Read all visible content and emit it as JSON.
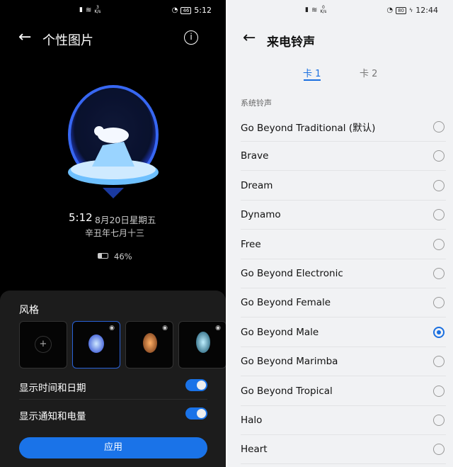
{
  "left": {
    "status": {
      "speed_value": "3",
      "speed_unit": "K/s",
      "battery": "46",
      "time": "5:12"
    },
    "title": "个性图片",
    "preview": {
      "time": "5:12",
      "date": "8月20日星期五",
      "lunar": "辛丑年七月十三",
      "battery": "46%"
    },
    "style_label": "风格",
    "toggles": [
      {
        "label": "显示时间和日期",
        "on": true
      },
      {
        "label": "显示通知和电量",
        "on": true
      }
    ],
    "apply_label": "应用",
    "accent": "#1a73e8"
  },
  "right": {
    "status": {
      "speed_value": "0",
      "speed_unit": "K/s",
      "battery": "80",
      "time": "12:44"
    },
    "title": "来电铃声",
    "tabs": [
      "卡 1",
      "卡 2"
    ],
    "section": "系统铃声",
    "ringtones": [
      "Go Beyond Traditional (默认)",
      "Brave",
      "Dream",
      "Dynamo",
      "Free",
      "Go Beyond Electronic",
      "Go Beyond Female",
      "Go Beyond Male",
      "Go Beyond Marimba",
      "Go Beyond Tropical",
      "Halo",
      "Heart"
    ],
    "selected": "Go Beyond Male",
    "accent": "#1a6fe0"
  }
}
